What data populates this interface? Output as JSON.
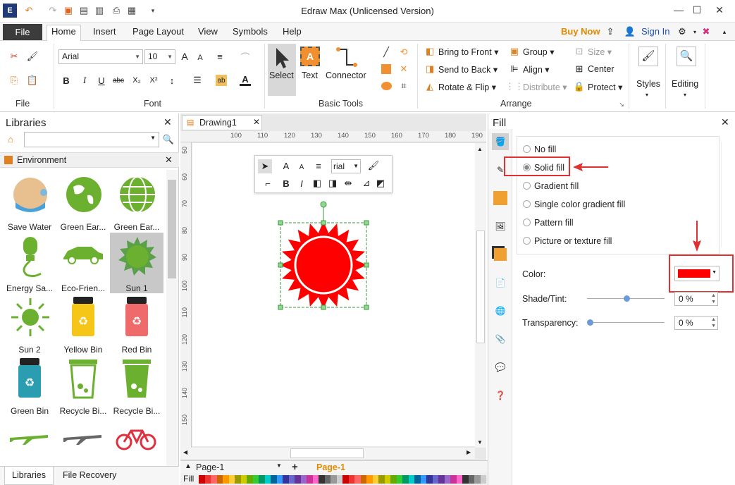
{
  "app": {
    "title": "Edraw Max (Unlicensed Version)"
  },
  "menu": {
    "file": "File",
    "tabs": [
      "Home",
      "Insert",
      "Page Layout",
      "View",
      "Symbols",
      "Help"
    ],
    "buy_now": "Buy Now",
    "sign_in": "Sign In"
  },
  "ribbon": {
    "groups": {
      "file": "File",
      "font": "Font",
      "basic_tools": "Basic Tools",
      "arrange": "Arrange"
    },
    "font": {
      "family": "Arial",
      "size": "10"
    },
    "tools": {
      "select": "Select",
      "text": "Text",
      "connector": "Connector"
    },
    "arrange": {
      "bring_to_front": "Bring to Front",
      "send_to_back": "Send to Back",
      "rotate_flip": "Rotate & Flip",
      "group": "Group",
      "align": "Align",
      "distribute": "Distribute",
      "size": "Size",
      "center": "Center",
      "protect": "Protect"
    },
    "styles": "Styles",
    "editing": "Editing"
  },
  "libraries": {
    "title": "Libraries",
    "category": "Environment",
    "items": [
      "Save Water",
      "Green Ear...",
      "Green Ear...",
      "Energy Sa...",
      "Eco-Frien...",
      "Sun 1",
      "Sun 2",
      "Yellow Bin",
      "Red Bin",
      "Green Bin",
      "Recycle Bi...",
      "Recycle Bi..."
    ],
    "tabs": {
      "libraries": "Libraries",
      "file_recovery": "File Recovery"
    }
  },
  "canvas": {
    "doc_tab": "Drawing1",
    "ruler_h": [
      "100",
      "110",
      "120",
      "130",
      "140",
      "150",
      "160",
      "170",
      "180",
      "190"
    ],
    "ruler_v": [
      "50",
      "60",
      "70",
      "80",
      "90",
      "100",
      "110",
      "120",
      "130",
      "140",
      "150"
    ],
    "minibar_font": "rial",
    "page_tab": "Page-1",
    "page_active": "Page-1",
    "fill_label": "Fill"
  },
  "fill": {
    "title": "Fill",
    "options": [
      "No fill",
      "Solid fill",
      "Gradient fill",
      "Single color gradient fill",
      "Pattern fill",
      "Picture or texture fill"
    ],
    "selected_index": 1,
    "color_label": "Color:",
    "color_value": "#ff0000",
    "shade_label": "Shade/Tint:",
    "shade_value": "0 %",
    "transparency_label": "Transparency:",
    "transparency_value": "0 %"
  },
  "colors": {
    "accent_red": "#e03030",
    "brand_orange": "#f0a030",
    "select_green": "#3a9a3a"
  }
}
